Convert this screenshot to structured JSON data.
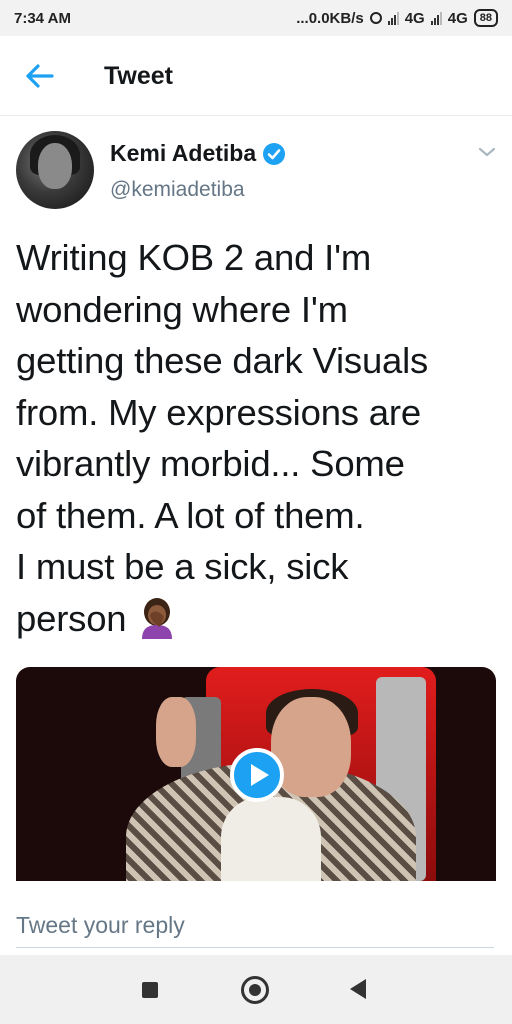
{
  "status_bar": {
    "time": "7:34 AM",
    "network_speed": "...0.0KB/s",
    "sim1_label": "4G",
    "sim2_label": "4G",
    "battery": "88"
  },
  "header": {
    "title": "Tweet",
    "back_icon": "arrow-left-icon"
  },
  "tweet": {
    "author_name": "Kemi Adetiba",
    "author_handle": "@kemiadetiba",
    "verified": true,
    "text": "Writing KOB 2 and I'm\nwondering where I'm\ngetting these dark Visuals\nfrom. My expressions are\nvibrantly morbid... Some\nof them. A lot of them.\nI must be a sick, sick\nperson",
    "emoji": "woman-facepalming-emoji",
    "media_type": "video"
  },
  "reply": {
    "placeholder": "Tweet your reply"
  },
  "colors": {
    "accent": "#1da1f2",
    "text": "#14171a",
    "muted": "#657786"
  }
}
